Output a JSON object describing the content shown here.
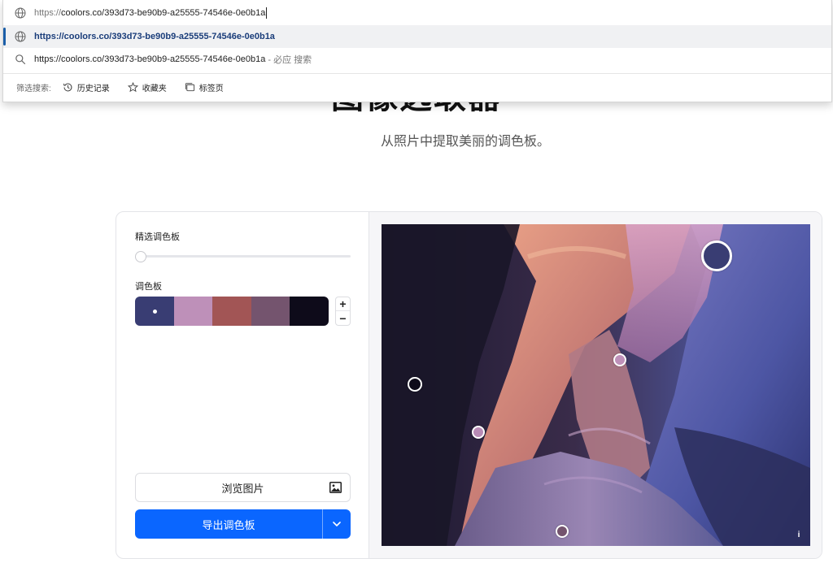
{
  "omnibox": {
    "input_scheme": "https://",
    "input_rest": "coolors.co/393d73-be90b9-a25555-74546e-0e0b1a",
    "suggestion_url": "https://coolors.co/393d73-be90b9-a25555-74546e-0e0b1a",
    "search_query": "https://coolors.co/393d73-be90b9-a25555-74546e-0e0b1a",
    "search_hint": "- 必应 搜索",
    "filter_label": "筛选搜索:",
    "filters": [
      "历史记录",
      "收藏夹",
      "标签页"
    ]
  },
  "page": {
    "title": "图像选取器",
    "subtitle": "从照片中提取美丽的调色板。"
  },
  "panel": {
    "featured_label": "精选调色板",
    "palette_label": "调色板",
    "swatches": [
      "#393d73",
      "#be90b9",
      "#a25555",
      "#74546e",
      "#0e0b1a"
    ],
    "stepper_plus": "+",
    "stepper_minus": "−",
    "browse_label": "浏览图片",
    "export_label": "导出调色板"
  },
  "photo": {
    "info": "i"
  },
  "colors": {
    "accent": "#0a66ff",
    "selected_row_bar": "#1a5ea8"
  }
}
